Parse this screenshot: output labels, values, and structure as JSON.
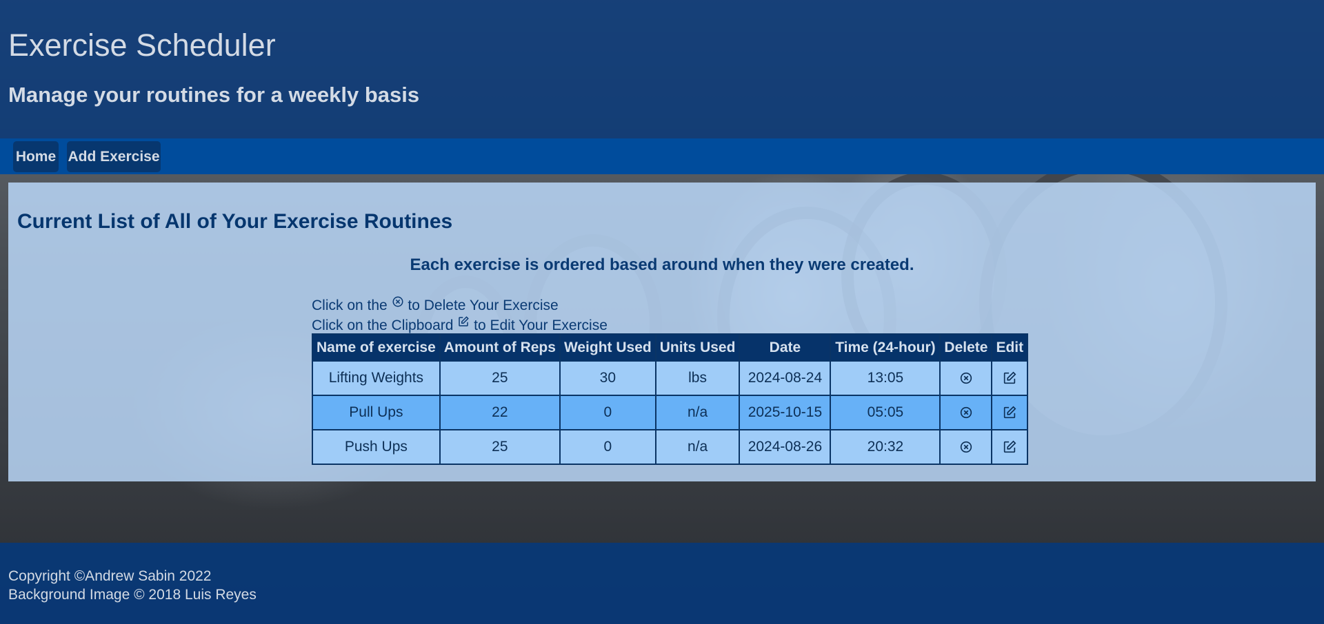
{
  "header": {
    "title": "Exercise Scheduler",
    "subtitle": "Manage your routines for a weekly basis"
  },
  "nav": {
    "home_label": "Home",
    "add_label": "Add Exercise"
  },
  "main": {
    "heading": "Current List of All of Your Exercise Routines",
    "order_note": "Each exercise is ordered based around when they were created.",
    "delete_instruction_pre": "Click on the",
    "delete_instruction_post": "to Delete Your Exercise",
    "edit_instruction_pre": "Click on the Clipboard",
    "edit_instruction_post": "to Edit Your Exercise"
  },
  "table": {
    "headers": [
      "Name of exercise",
      "Amount of Reps",
      "Weight Used",
      "Units Used",
      "Date",
      "Time (24-hour)",
      "Delete",
      "Edit"
    ],
    "rows": [
      {
        "name": "Lifting Weights",
        "reps": "25",
        "weight": "30",
        "units": "lbs",
        "date": "2024-08-24",
        "time": "13:05"
      },
      {
        "name": "Pull Ups",
        "reps": "22",
        "weight": "0",
        "units": "n/a",
        "date": "2025-10-15",
        "time": "05:05"
      },
      {
        "name": "Push Ups",
        "reps": "25",
        "weight": "0",
        "units": "n/a",
        "date": "2024-08-26",
        "time": "20:32"
      }
    ]
  },
  "icons": {
    "delete": "circle-x-icon",
    "edit": "edit-clipboard-icon"
  },
  "colors": {
    "header_bg": "#08387a",
    "nav_bg": "#004c9c",
    "table_header_bg": "#06336a",
    "row_light": "#9fccf8",
    "row_dark": "#67b1f7"
  },
  "footer": {
    "copyright": "Copyright ©Andrew Sabin 2022",
    "image_credit": "Background Image © 2018 Luis Reyes"
  }
}
